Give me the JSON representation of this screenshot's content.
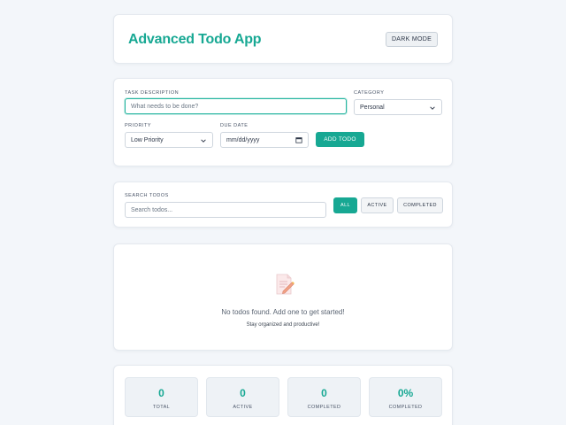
{
  "header": {
    "title": "Advanced Todo App",
    "dark_mode_label": "DARK MODE"
  },
  "form": {
    "task_label": "TASK DESCRIPTION",
    "task_placeholder": "What needs to be done?",
    "category_label": "CATEGORY",
    "category_value": "Personal",
    "priority_label": "PRIORITY",
    "priority_value": "Low Priority",
    "due_label": "DUE DATE",
    "due_placeholder": "mm/dd/yyyy",
    "add_label": "ADD TODO"
  },
  "search": {
    "label": "SEARCH TODOS",
    "placeholder": "Search todos...",
    "filters": [
      "ALL",
      "ACTIVE",
      "COMPLETED"
    ],
    "active_filter": "ALL"
  },
  "empty": {
    "icon": "memo-pencil-icon",
    "title": "No todos found. Add one to get started!",
    "subtitle": "Stay organized and productive!"
  },
  "stats": [
    {
      "value": "0",
      "label": "TOTAL"
    },
    {
      "value": "0",
      "label": "ACTIVE"
    },
    {
      "value": "0",
      "label": "COMPLETED"
    },
    {
      "value": "0%",
      "label": "COMPLETED"
    }
  ],
  "colors": {
    "accent": "#17a893",
    "background": "#f3f6fa",
    "danger_strip": "#e05a5a",
    "success_strip": "#2bb673"
  }
}
